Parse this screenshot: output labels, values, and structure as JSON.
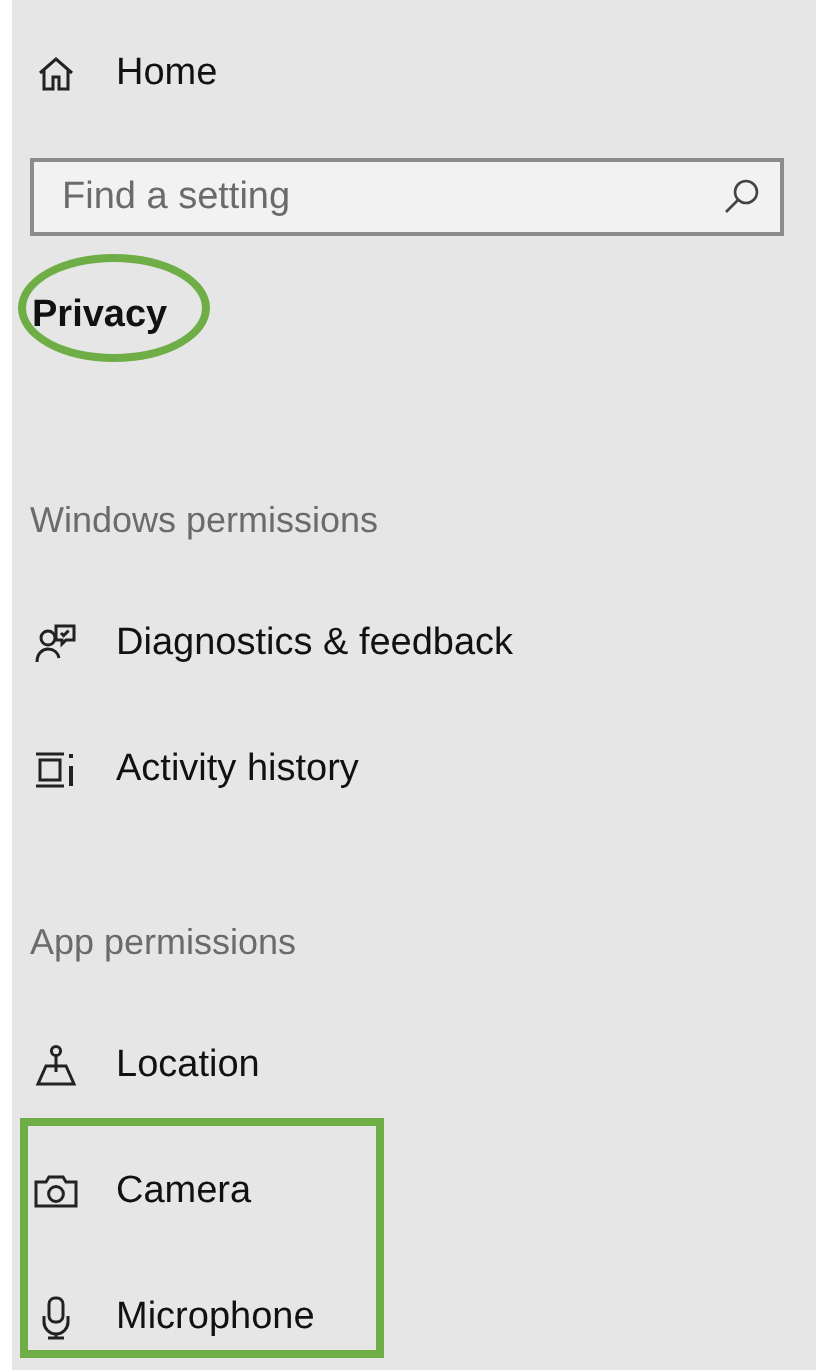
{
  "home": {
    "label": "Home",
    "kind": "home"
  },
  "search": {
    "placeholder": "Find a setting"
  },
  "heading": {
    "text": "Privacy",
    "circled": true
  },
  "sections": [
    {
      "title": "Windows permissions",
      "items": [
        {
          "label": "Diagnostics & feedback",
          "kind": "diagnostics",
          "highlighted": false
        },
        {
          "label": "Activity history",
          "kind": "activity",
          "highlighted": false
        }
      ]
    },
    {
      "title": "App permissions",
      "items": [
        {
          "label": "Location",
          "kind": "location",
          "highlighted": false
        },
        {
          "label": "Camera",
          "kind": "camera",
          "highlighted": true
        },
        {
          "label": "Microphone",
          "kind": "microphone",
          "highlighted": true
        }
      ]
    }
  ]
}
